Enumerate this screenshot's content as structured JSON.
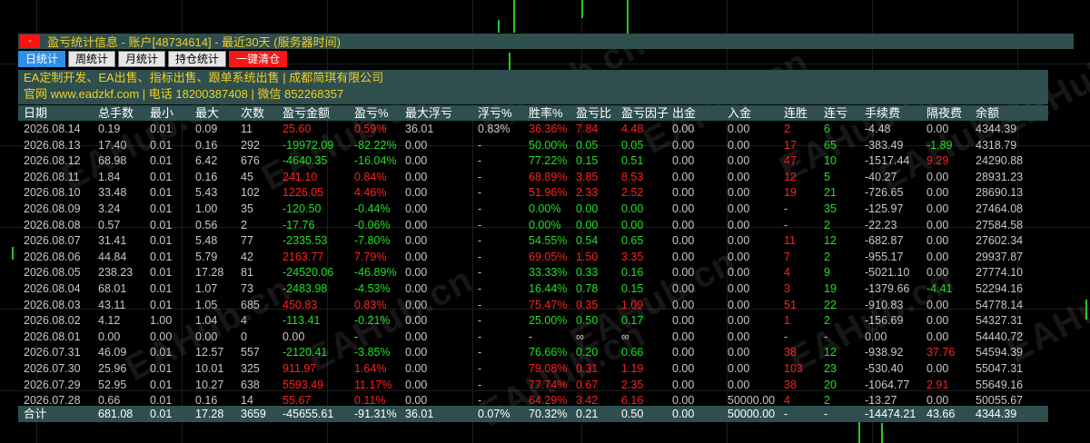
{
  "panel": {
    "close_label": "-",
    "title": "盈亏统计信息 - 账户[48734614] - 最近30天 (服务器时间)"
  },
  "tabs": [
    {
      "label": "日统计",
      "active": true
    },
    {
      "label": "周统计",
      "active": false
    },
    {
      "label": "月统计",
      "active": false
    },
    {
      "label": "持仓统计",
      "active": false
    },
    {
      "label": "一键清仓",
      "danger": true
    }
  ],
  "ad": {
    "line1": "EA定制开发、EA出售、指标出售、跟单系统出售 | 成都简琪有限公司",
    "line2": "官网 www.eadzkf.com | 电话 18200387408 | 微信 852268357"
  },
  "watermark_text": "EAHub.cn",
  "colors": {
    "panel_bg": "#2f4f4f",
    "title_text": "#f0d020",
    "profit": "#ff2020",
    "loss": "#20e020",
    "active_tab": "#2e8fe8",
    "danger_tab": "#f01818"
  },
  "table": {
    "headers": [
      "日期",
      "总手数",
      "最小",
      "最大",
      "次数",
      "盈亏金额",
      "盈亏%",
      "最大浮亏",
      "浮亏%",
      "胜率%",
      "盈亏比",
      "盈亏因子",
      "出金",
      "入金",
      "连胜",
      "连亏",
      "手续费",
      "隔夜费",
      "余额"
    ],
    "rows": [
      [
        "2026.08.14",
        "0.19",
        "0.01",
        "0.09",
        "11",
        "25.60",
        "0.59%",
        "36.01",
        "0.83%",
        "36.36%",
        "7.84",
        "4.48",
        "0.00",
        "0.00",
        "2",
        "6",
        "-4.48",
        "0.00",
        "4344.39"
      ],
      [
        "2026.08.13",
        "17.40",
        "0.01",
        "0.16",
        "292",
        "-19972.09",
        "-82.22%",
        "0.00",
        "-",
        "50.00%",
        "0.05",
        "0.05",
        "0.00",
        "0.00",
        "17",
        "65",
        "-383.49",
        "-1.89",
        "4318.79"
      ],
      [
        "2026.08.12",
        "68.98",
        "0.01",
        "6.42",
        "676",
        "-4640.35",
        "-16.04%",
        "0.00",
        "-",
        "77.22%",
        "0.15",
        "0.51",
        "0.00",
        "0.00",
        "47",
        "10",
        "-1517.44",
        "9.29",
        "24290.88"
      ],
      [
        "2026.08.11",
        "1.84",
        "0.01",
        "0.16",
        "45",
        "241.10",
        "0.84%",
        "0.00",
        "-",
        "68.89%",
        "3.85",
        "8.53",
        "0.00",
        "0.00",
        "12",
        "5",
        "-40.27",
        "0.00",
        "28931.23"
      ],
      [
        "2026.08.10",
        "33.48",
        "0.01",
        "5.43",
        "102",
        "1226.05",
        "4.46%",
        "0.00",
        "-",
        "51.96%",
        "2.33",
        "2.52",
        "0.00",
        "0.00",
        "19",
        "21",
        "-726.65",
        "0.00",
        "28690.13"
      ],
      [
        "2026.08.09",
        "3.24",
        "0.01",
        "1.00",
        "35",
        "-120.50",
        "-0.44%",
        "0.00",
        "-",
        "0.00%",
        "0.00",
        "0.00",
        "0.00",
        "0.00",
        "-",
        "35",
        "-125.97",
        "0.00",
        "27464.08"
      ],
      [
        "2026.08.08",
        "0.57",
        "0.01",
        "0.56",
        "2",
        "-17.76",
        "-0.06%",
        "0.00",
        "-",
        "0.00%",
        "0.00",
        "0.00",
        "0.00",
        "0.00",
        "-",
        "2",
        "-22.23",
        "0.00",
        "27584.58"
      ],
      [
        "2026.08.07",
        "31.41",
        "0.01",
        "5.48",
        "77",
        "-2335.53",
        "-7.80%",
        "0.00",
        "-",
        "54.55%",
        "0.54",
        "0.65",
        "0.00",
        "0.00",
        "11",
        "12",
        "-682.87",
        "0.00",
        "27602.34"
      ],
      [
        "2026.08.06",
        "44.84",
        "0.01",
        "5.79",
        "42",
        "2163.77",
        "7.79%",
        "0.00",
        "-",
        "69.05%",
        "1.50",
        "3.35",
        "0.00",
        "0.00",
        "7",
        "2",
        "-955.17",
        "0.00",
        "29937.87"
      ],
      [
        "2026.08.05",
        "238.23",
        "0.01",
        "17.28",
        "81",
        "-24520.06",
        "-46.89%",
        "0.00",
        "-",
        "33.33%",
        "0.33",
        "0.16",
        "0.00",
        "0.00",
        "4",
        "9",
        "-5021.10",
        "0.00",
        "27774.10"
      ],
      [
        "2026.08.04",
        "68.01",
        "0.01",
        "1.07",
        "73",
        "-2483.98",
        "-4.53%",
        "0.00",
        "-",
        "16.44%",
        "0.78",
        "0.15",
        "0.00",
        "0.00",
        "3",
        "19",
        "-1379.66",
        "-4.41",
        "52294.16"
      ],
      [
        "2026.08.03",
        "43.11",
        "0.01",
        "1.05",
        "685",
        "450.83",
        "0.83%",
        "0.00",
        "-",
        "75.47%",
        "0.35",
        "1.09",
        "0.00",
        "0.00",
        "51",
        "22",
        "-910.83",
        "0.00",
        "54778.14"
      ],
      [
        "2026.08.02",
        "4.12",
        "1.00",
        "1.04",
        "4",
        "-113.41",
        "-0.21%",
        "0.00",
        "-",
        "25.00%",
        "0.50",
        "0.17",
        "0.00",
        "0.00",
        "1",
        "2",
        "-156.69",
        "0.00",
        "54327.31"
      ],
      [
        "2026.08.01",
        "0.00",
        "0.00",
        "0.00",
        "0",
        "0.00",
        "-",
        "0.00",
        "-",
        "-",
        "∞",
        "∞",
        "0.00",
        "0.00",
        "-",
        "-",
        "0.00",
        "0.00",
        "54440.72"
      ],
      [
        "2026.07.31",
        "46.09",
        "0.01",
        "12.57",
        "557",
        "-2120.41",
        "-3.85%",
        "0.00",
        "-",
        "76.66%",
        "0.20",
        "0.66",
        "0.00",
        "0.00",
        "38",
        "12",
        "-938.92",
        "37.76",
        "54594.39"
      ],
      [
        "2026.07.30",
        "25.96",
        "0.01",
        "10.01",
        "325",
        "911.97",
        "1.64%",
        "0.00",
        "-",
        "79.08%",
        "0.31",
        "1.19",
        "0.00",
        "0.00",
        "103",
        "23",
        "-530.40",
        "0.00",
        "55047.31"
      ],
      [
        "2026.07.29",
        "52.95",
        "0.01",
        "10.27",
        "638",
        "5593.49",
        "11.17%",
        "0.00",
        "-",
        "77.74%",
        "0.67",
        "2.35",
        "0.00",
        "0.00",
        "38",
        "20",
        "-1064.77",
        "2.91",
        "55649.16"
      ],
      [
        "2026.07.28",
        "0.66",
        "0.01",
        "0.16",
        "14",
        "55.67",
        "0.11%",
        "0.00",
        "-",
        "64.29%",
        "3.42",
        "6.16",
        "0.00",
        "50000.00",
        "4",
        "2",
        "-13.27",
        "0.00",
        "50055.67"
      ]
    ],
    "totals": [
      "合计",
      "681.08",
      "0.01",
      "17.28",
      "3659",
      "-45655.61",
      "-91.31%",
      "36.01",
      "0.07%",
      "70.32%",
      "0.21",
      "0.50",
      "0.00",
      "50000.00",
      "-",
      "-",
      "-14474.21",
      "43.66",
      "4344.39"
    ]
  }
}
